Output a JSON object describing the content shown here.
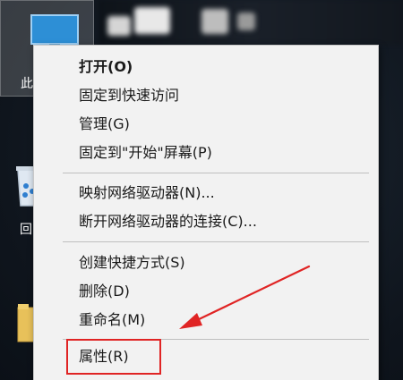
{
  "desktop": {
    "icons": [
      {
        "name": "this-pc",
        "label": "此"
      },
      {
        "name": "recycle-bin",
        "label": "回"
      },
      {
        "name": "folder",
        "label": ""
      }
    ]
  },
  "context_menu": {
    "items": [
      {
        "id": "open",
        "label": "打开(O)",
        "bold": true
      },
      {
        "id": "pin-quick-access",
        "label": "固定到快速访问"
      },
      {
        "id": "manage",
        "label": "管理(G)"
      },
      {
        "id": "pin-start",
        "label": "固定到\"开始\"屏幕(P)"
      },
      {
        "id": "map-network-drive",
        "label": "映射网络驱动器(N)..."
      },
      {
        "id": "disconnect-network-drive",
        "label": "断开网络驱动器的连接(C)..."
      },
      {
        "id": "create-shortcut",
        "label": "创建快捷方式(S)"
      },
      {
        "id": "delete",
        "label": "删除(D)"
      },
      {
        "id": "rename",
        "label": "重命名(M)"
      },
      {
        "id": "properties",
        "label": "属性(R)"
      }
    ]
  },
  "annotation": {
    "color": "#e02424",
    "highlighted_item": "properties"
  }
}
